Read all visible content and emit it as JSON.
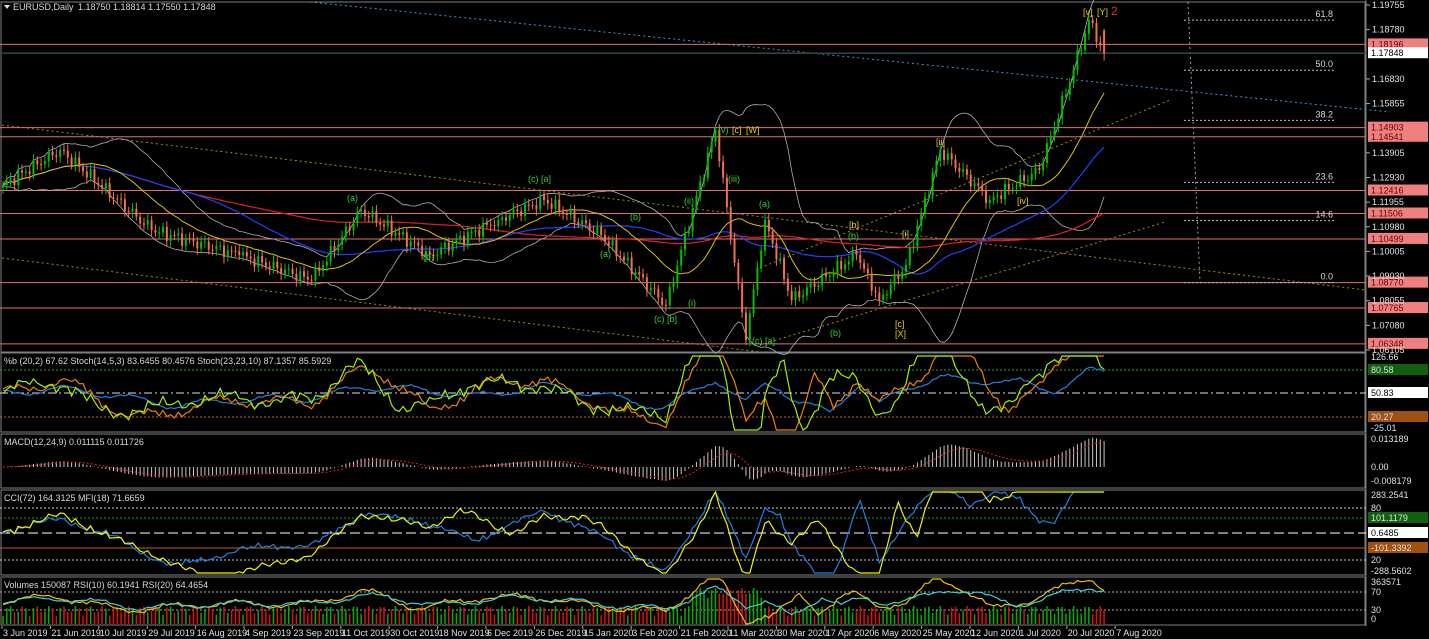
{
  "header": {
    "symbol": "EURUSD,Daily",
    "ohlc": "1.18750 1.18814 1.17550 1.17848"
  },
  "colors": {
    "background": "#000000",
    "bull": "#00c000",
    "bear": "#f07050",
    "level_line": "#e07070",
    "current_price": "#ffffff",
    "ma_fast": "#e0c000",
    "ma_mid": "#2040ff",
    "ma_slow": "#e02020",
    "bands": "#b0b0b0"
  },
  "chart_data": {
    "type": "candlestick",
    "title": "EURUSD,Daily",
    "bars": 290,
    "price_waypoints": [
      {
        "bar": 0,
        "close": 1.1263
      },
      {
        "bar": 15,
        "close": 1.1402
      },
      {
        "bar": 39,
        "close": 1.1085
      },
      {
        "bar": 62,
        "close": 1.0986
      },
      {
        "bar": 81,
        "close": 1.0887
      },
      {
        "bar": 94,
        "close": 1.1164
      },
      {
        "bar": 112,
        "close": 1.0986
      },
      {
        "bar": 130,
        "close": 1.1125
      },
      {
        "bar": 142,
        "close": 1.1204
      },
      {
        "bar": 157,
        "close": 1.1065
      },
      {
        "bar": 174,
        "close": 1.0788
      },
      {
        "bar": 187,
        "close": 1.1481
      },
      {
        "bar": 195,
        "close": 1.065
      },
      {
        "bar": 200,
        "close": 1.1125
      },
      {
        "bar": 207,
        "close": 1.0808
      },
      {
        "bar": 224,
        "close": 1.0986
      },
      {
        "bar": 230,
        "close": 1.0808
      },
      {
        "bar": 237,
        "close": 1.0946
      },
      {
        "bar": 246,
        "close": 1.1402
      },
      {
        "bar": 259,
        "close": 1.1204
      },
      {
        "bar": 272,
        "close": 1.1323
      },
      {
        "bar": 281,
        "close": 1.1718
      },
      {
        "bar": 285,
        "close": 1.1916
      },
      {
        "bar": 289,
        "close": 1.17848
      }
    ],
    "last_bar": {
      "open": 1.1875,
      "high": 1.18814,
      "low": 1.1755,
      "close": 1.17848
    },
    "ylim": [
      1.06105,
      1.19755
    ],
    "y_ticks": [
      "1.19755",
      "1.18780",
      "1.16830",
      "1.15855",
      "1.13905",
      "1.12930",
      "1.11955",
      "1.10980",
      "1.10005",
      "1.09030",
      "1.08055",
      "1.07080",
      "1.06105"
    ],
    "level_lines": [
      "1.18196",
      "1.14903",
      "1.14541",
      "1.12416",
      "1.11506",
      "1.10499",
      "1.08770",
      "1.07765",
      "1.06348"
    ],
    "current_price": "1.17848",
    "x_ticks": [
      "3 Jun 2019",
      "21 Jun 2019",
      "10 Jul 2019",
      "29 Jul 2019",
      "16 Aug 2019",
      "4 Sep 2019",
      "23 Sep 2019",
      "11 Oct 2019",
      "30 Oct 2019",
      "18 Nov 2019",
      "6 Dec 2019",
      "26 Dec 2019",
      "15 Jan 2020",
      "3 Feb 2020",
      "21 Feb 2020",
      "11 Mar 2020",
      "30 Mar 2020",
      "17 Apr 2020",
      "6 May 2020",
      "25 May 2020",
      "12 Jun 2020",
      "1 Jul 2020",
      "20 Jul 2020",
      "7 Aug 2020"
    ],
    "fibonacci": {
      "price_0": 1.0877,
      "price_100": 1.2558,
      "levels": [
        {
          "ratio": 0.618,
          "label": "61.8"
        },
        {
          "ratio": 0.5,
          "label": "50.0"
        },
        {
          "ratio": 0.382,
          "label": "38.2"
        },
        {
          "ratio": 0.236,
          "label": "23.6"
        },
        {
          "ratio": 0.146,
          "label": "14.6"
        },
        {
          "ratio": 0.0,
          "label": "0.0"
        }
      ]
    },
    "wave_labels": [
      "[v]",
      "[Y]",
      "2",
      "(v)",
      "[c]",
      "[W]",
      "(c) [a]",
      "[ii]",
      "[iv]",
      "[b]",
      "(b)",
      "[i]",
      "[c]",
      "[X]",
      "(c) [b]",
      "(c) [a]",
      "(b)",
      "(a)",
      "(b)",
      "(a)",
      "(b)",
      "(iii)",
      "(ii)",
      "(i)",
      "(a)"
    ],
    "indicators": {
      "stoch": {
        "title": "%b (20,2) 67.62  Stoch(14,5,3) 83.6455 80.4576  Stoch(23,23,10) 87.1357 85.5929",
        "axis": [
          "126.66",
          "80",
          "50.83",
          "20",
          "-25.01"
        ],
        "box_high": "80.58",
        "box_low": "20.27"
      },
      "macd": {
        "title": "MACD(12,24,9) 0.011115 0.011726",
        "axis": [
          "0.013189",
          "0.00",
          "-0.008179"
        ]
      },
      "cci": {
        "title": "CCI(72) 164.3125  MFI(18) 71.6659",
        "axis": [
          "283.2541",
          "80",
          "101.1179",
          "0.6485",
          "-101.3392",
          "20",
          "-288.5602"
        ]
      },
      "volume_rsi": {
        "title": "Volumes 150087  RSI(10) 60.1941  RSI(20) 64.4654",
        "axis": [
          "363571",
          "70",
          "30",
          "0"
        ]
      }
    }
  }
}
